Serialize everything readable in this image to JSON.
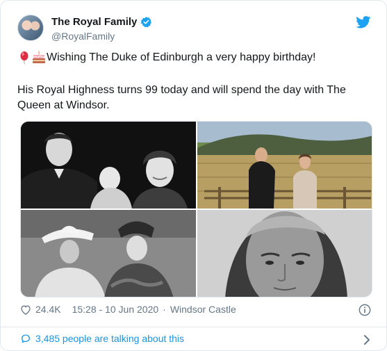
{
  "account": {
    "name": "The Royal Family",
    "handle": "@RoyalFamily"
  },
  "tweet": {
    "line1": "Wishing The Duke of Edinburgh a very happy birthday!",
    "line2": "His Royal Highness turns 99 today and will spend the day with The Queen at Windsor.",
    "emojis": [
      "balloon",
      "birthday-cake"
    ]
  },
  "photos": [
    "photo-couple-with-baby",
    "photo-couple-in-field",
    "photo-couple-in-hats",
    "photo-portrait"
  ],
  "meta": {
    "likes": "24.4K",
    "timestamp": "15:28 - 10 Jun 2020",
    "separator": "·",
    "location": "Windsor Castle"
  },
  "conversation": {
    "label": "3,485 people are talking about this"
  },
  "colors": {
    "accent": "#1da1f2",
    "link": "#1b95e0",
    "muted": "#657786",
    "border": "#e1e8ed"
  }
}
